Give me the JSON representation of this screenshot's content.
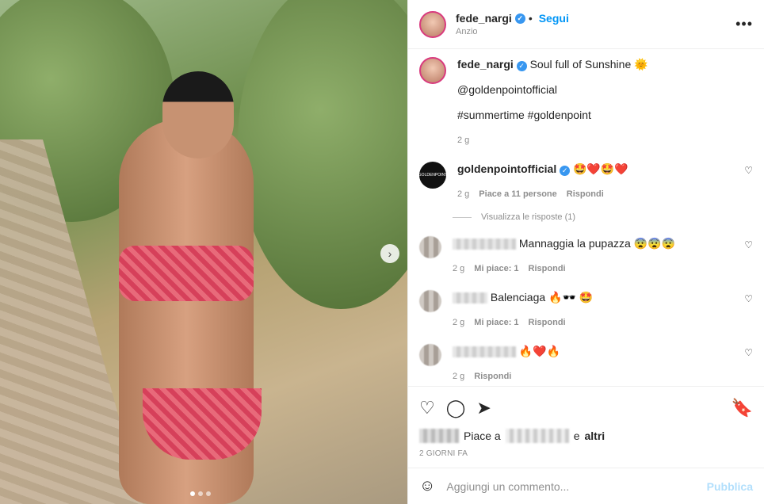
{
  "post": {
    "author": "fede_nargi",
    "follow_label": "Segui",
    "header_sub": "Anzio",
    "caption_text": "Soul full of Sunshine 🌞",
    "mention": "@goldenpointofficial",
    "hashtags": "#summertime #goldenpoint",
    "caption_time": "2 g",
    "more_label": "•••"
  },
  "comments": [
    {
      "user": "goldenpointofficial",
      "text": "🤩❤️🤩❤️",
      "time": "2 g",
      "likes": "Piace a 11 persone",
      "reply": "Rispondi",
      "view_replies": "Visualizza le risposte (1)"
    },
    {
      "user": "",
      "text": "Mannaggia la pupazza 😨😨😨",
      "time": "2 g",
      "likes": "Mi piace: 1",
      "reply": "Rispondi"
    },
    {
      "user": "",
      "text": "Balenciaga 🔥🕶️ 🤩",
      "time": "2 g",
      "likes": "Mi piace: 1",
      "reply": "Rispondi"
    },
    {
      "user": "",
      "text": "🔥❤️🔥",
      "time": "2 g",
      "reply": "Rispondi"
    }
  ],
  "likes_line": {
    "prefix": "Piace a",
    "suffix": "e",
    "others": "altri"
  },
  "post_date": "2 GIORNI FA",
  "add_comment": {
    "placeholder": "Aggiungi un commento...",
    "publish": "Pubblica"
  },
  "icons": {
    "like": "heart-icon",
    "comment": "comment-icon",
    "share": "share-icon",
    "save": "bookmark-icon"
  }
}
